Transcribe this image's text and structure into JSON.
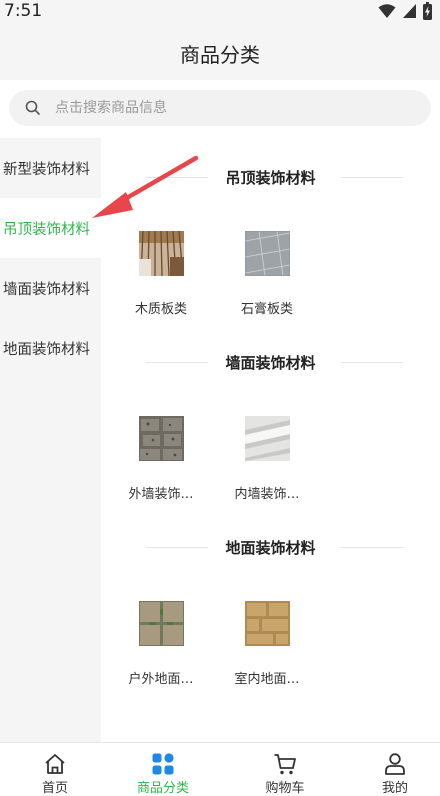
{
  "status_bar": {
    "time": "7:51"
  },
  "header": {
    "title": "商品分类"
  },
  "search": {
    "placeholder": "点击搜索商品信息"
  },
  "sidebar": {
    "items": [
      {
        "label": "新型装饰材料",
        "active": false
      },
      {
        "label": "吊顶装饰材料",
        "active": true
      },
      {
        "label": "墙面装饰材料",
        "active": false
      },
      {
        "label": "地面装饰材料",
        "active": false
      }
    ]
  },
  "sections": [
    {
      "title": "吊顶装饰材料",
      "products": [
        {
          "name": "木质板类"
        },
        {
          "name": "石膏板类"
        }
      ]
    },
    {
      "title": "墙面装饰材料",
      "products": [
        {
          "name": "外墙装饰…"
        },
        {
          "name": "内墙装饰…"
        }
      ]
    },
    {
      "title": "地面装饰材料",
      "products": [
        {
          "name": "户外地面…"
        },
        {
          "name": "室内地面…"
        }
      ]
    }
  ],
  "tabbar": {
    "items": [
      {
        "label": "首页",
        "icon": "home-icon"
      },
      {
        "label": "商品分类",
        "icon": "category-icon"
      },
      {
        "label": "购物车",
        "icon": "cart-icon"
      },
      {
        "label": "我的",
        "icon": "user-icon"
      }
    ],
    "active_index": 1
  },
  "colors": {
    "accent": "#2fb64a",
    "annotation_arrow": "#e8464b",
    "category_icon": "#1e88e5"
  }
}
